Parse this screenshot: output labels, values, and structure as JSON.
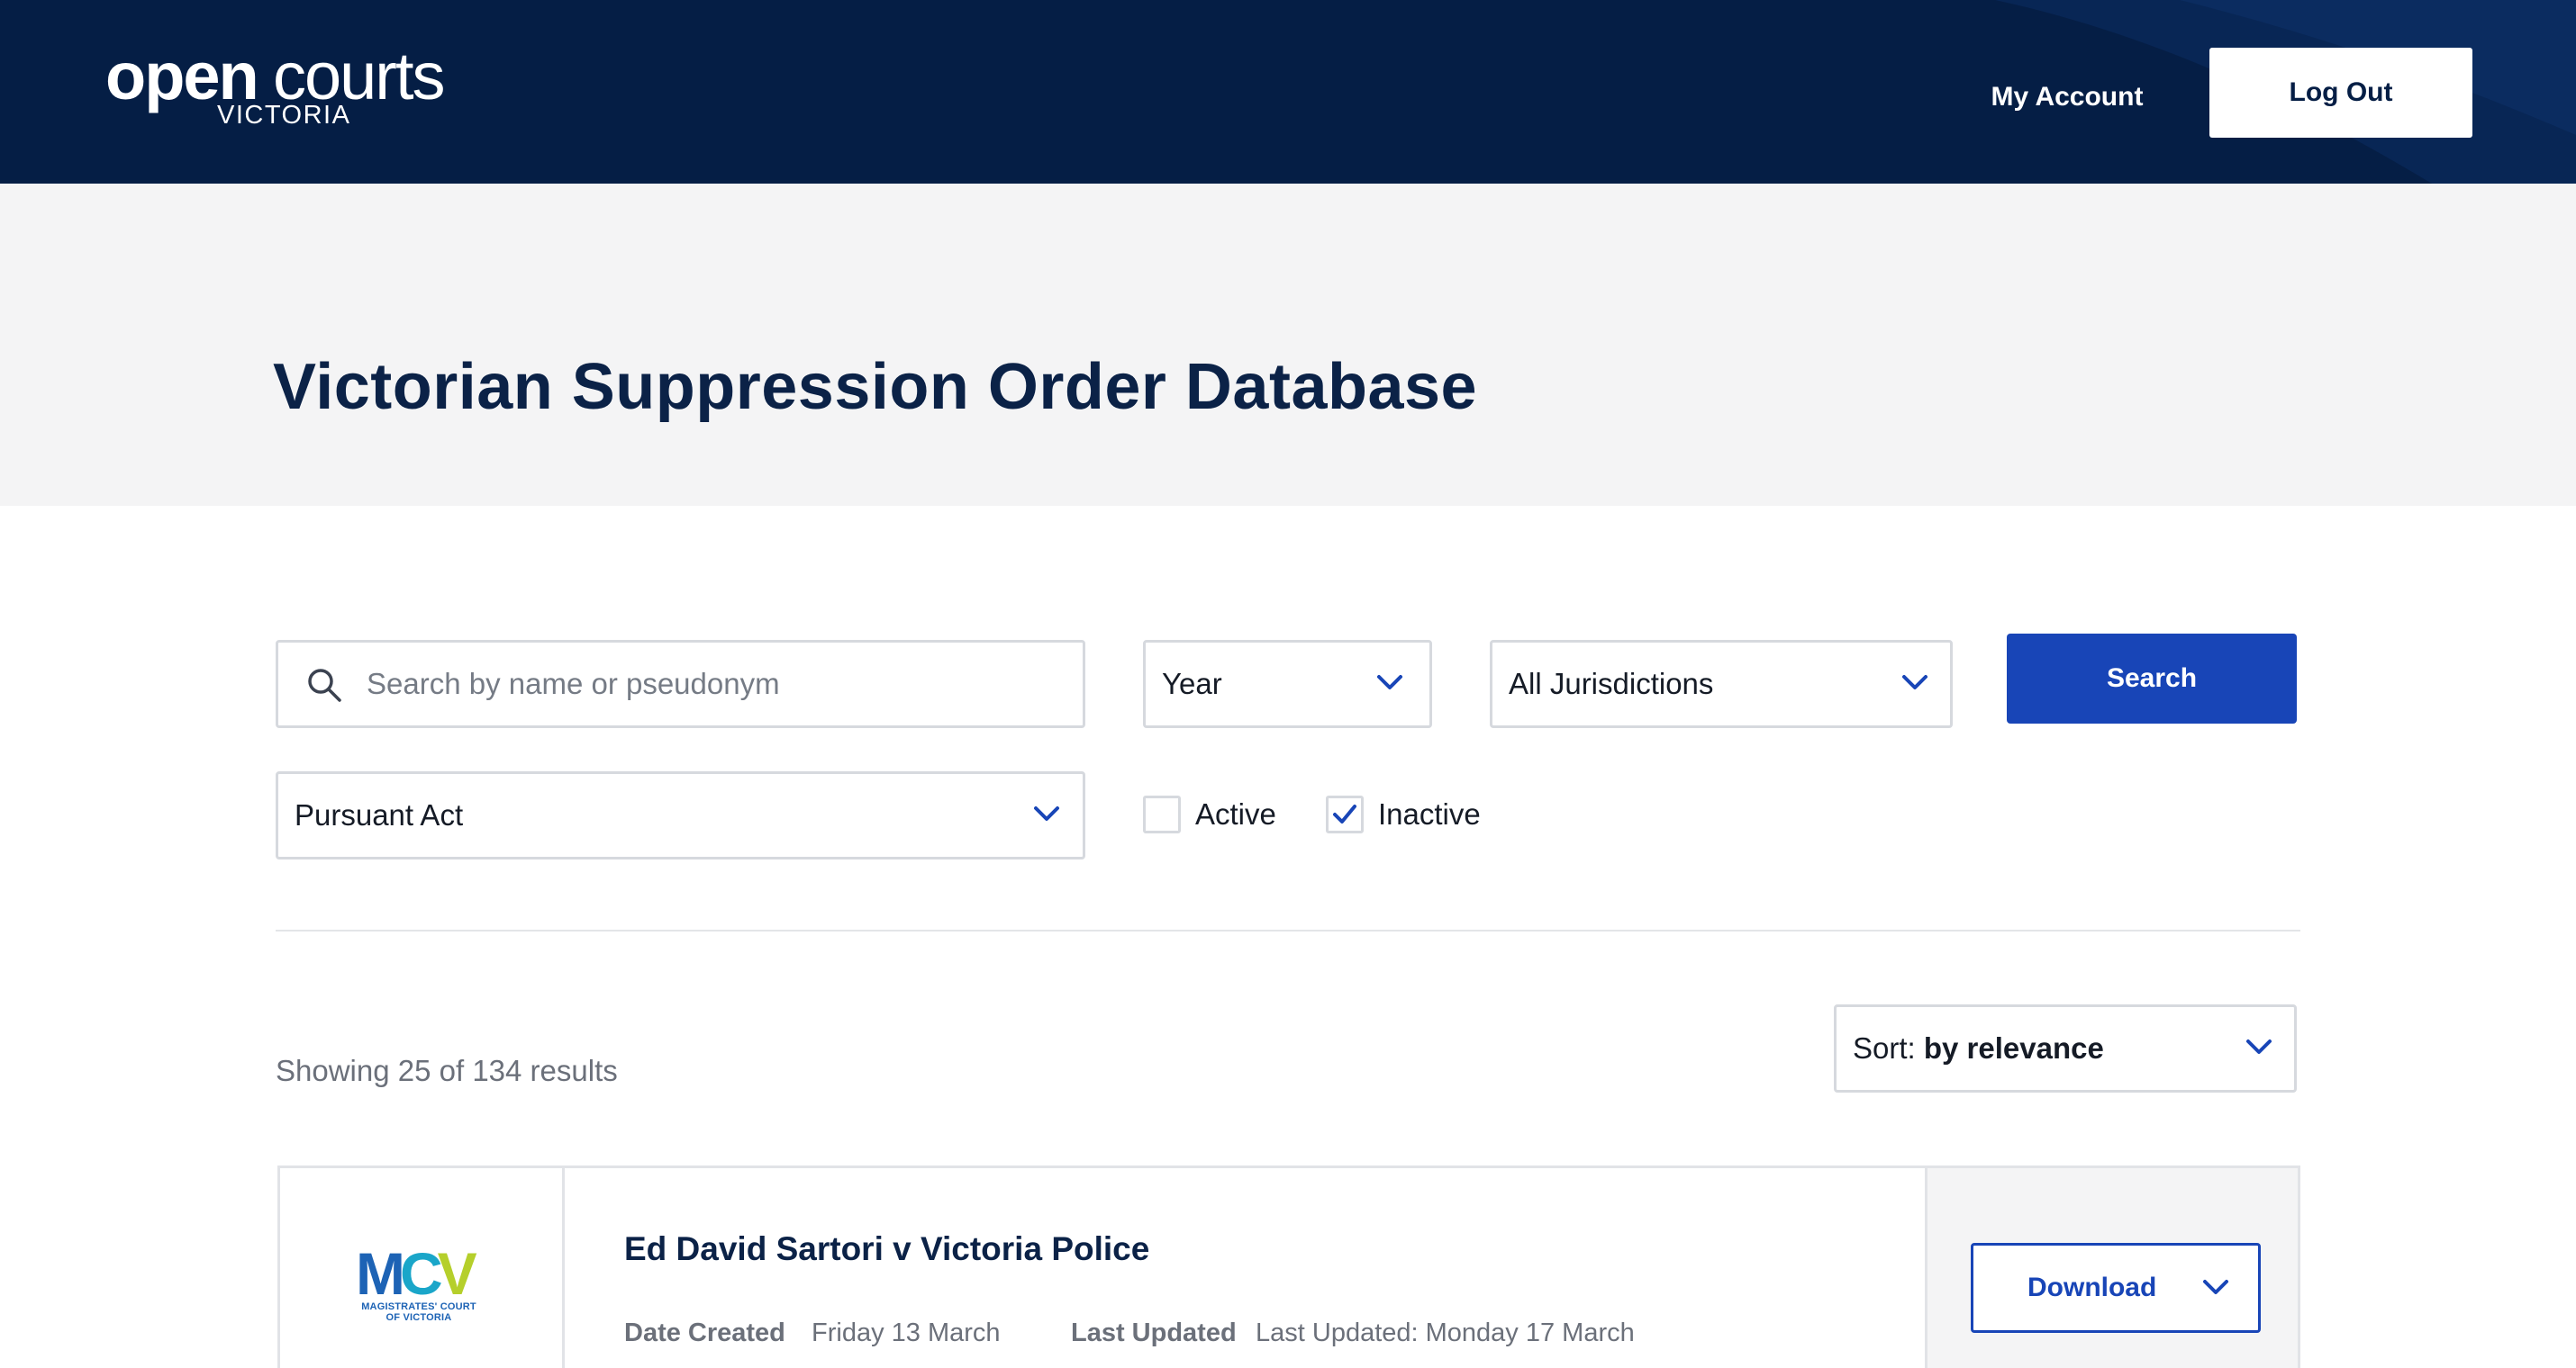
{
  "header": {
    "logo": {
      "word1": "open",
      "word2": "courts",
      "word3": "VICTORIA"
    },
    "my_account_label": "My Account",
    "logout_label": "Log Out"
  },
  "hero": {
    "title": "Victorian Suppression Order Database"
  },
  "filters": {
    "search": {
      "placeholder": "Search by name or pseudonym",
      "value": ""
    },
    "year": {
      "selected": "Year"
    },
    "jurisdiction": {
      "selected": "All Jurisdictions"
    },
    "pursuant_act": {
      "selected": "Pursuant Act"
    },
    "search_button_label": "Search",
    "status_checkboxes": [
      {
        "label": "Active",
        "checked": false
      },
      {
        "label": "Inactive",
        "checked": true
      }
    ]
  },
  "results": {
    "count_text": "Showing 25 of 134 results",
    "sort": {
      "prefix": "Sort:",
      "value": "by relevance"
    },
    "items": [
      {
        "court_logo": {
          "letters": [
            "M",
            "C",
            "V"
          ],
          "subtext_line1": "MAGISTRATES' COURT",
          "subtext_line2": "OF VICTORIA"
        },
        "title": "Ed David Sartori v Victoria Police",
        "date_created_label": "Date Created",
        "date_created": "Friday 13 March",
        "last_updated_label": "Last Updated",
        "last_updated": "Last Updated: Monday 17 March",
        "download_label": "Download"
      }
    ]
  },
  "colors": {
    "header_bg": "#051e45",
    "hero_bg": "#f4f4f5",
    "primary": "#1845b7",
    "title_text": "#0b2247",
    "muted_text": "#6b707a",
    "border": "#d6d9de"
  },
  "icons": {
    "search": "magnifier-icon",
    "dropdown": "chevron-down-icon",
    "checkbox_checked": "checkmark-icon"
  }
}
